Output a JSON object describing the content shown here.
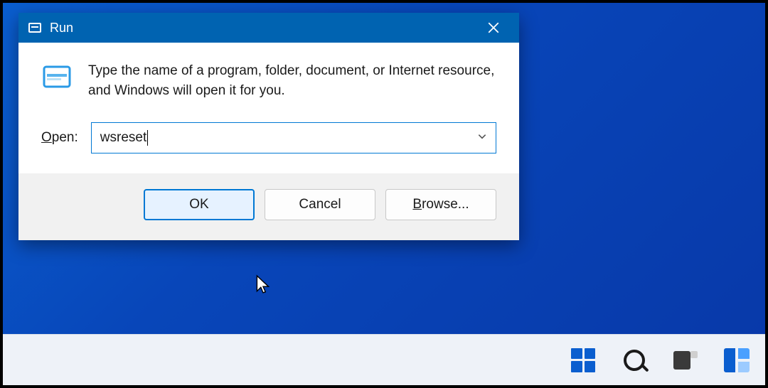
{
  "window": {
    "title": "Run",
    "description": "Type the name of a program, folder, document, or Internet resource, and Windows will open it for you.",
    "open_label_underline": "O",
    "open_label_rest": "pen:",
    "input_value": "wsreset",
    "buttons": {
      "ok": "OK",
      "cancel": "Cancel",
      "browse_underline": "B",
      "browse_rest": "rowse..."
    }
  },
  "taskbar": {
    "items": [
      "start",
      "search",
      "taskview",
      "widgets"
    ]
  }
}
